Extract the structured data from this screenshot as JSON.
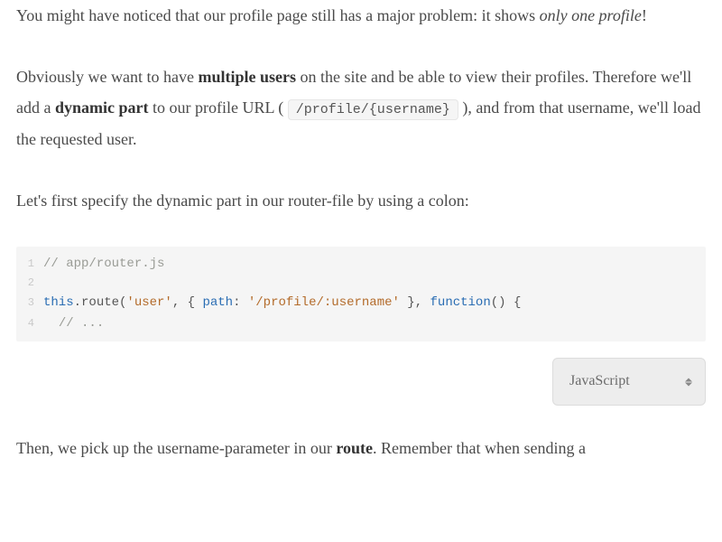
{
  "paragraphs": {
    "p1": {
      "a": "You might have noticed that our profile page still has a major problem: it shows ",
      "em": "only one profile",
      "b": "!"
    },
    "p2": {
      "a": "Obviously we want to have ",
      "strong1": "multiple users",
      "b": " on the site and be able to view their profiles. Therefore we'll add a ",
      "strong2": "dynamic part",
      "c": " to our profile URL ( ",
      "code": "/profile/{username}",
      "d": " ), and from that username, we'll load the requested user."
    },
    "p3": "Let's first specify the dynamic part in our router-file by using a colon:",
    "p4": {
      "a": "Then, we pick up the username-parameter in our ",
      "strong": "route",
      "b": ". Remember that when sending a"
    }
  },
  "code": {
    "lines": [
      {
        "n": "1",
        "tokens": [
          {
            "t": "// app/router.js",
            "c": "tok-comment"
          }
        ]
      },
      {
        "n": "2",
        "tokens": [
          {
            "t": "",
            "c": ""
          }
        ]
      },
      {
        "n": "3",
        "tokens": [
          {
            "t": "this",
            "c": "tok-kw"
          },
          {
            "t": ".route(",
            "c": "tok-punc"
          },
          {
            "t": "'user'",
            "c": "tok-str"
          },
          {
            "t": ", { ",
            "c": "tok-punc"
          },
          {
            "t": "path",
            "c": "tok-key"
          },
          {
            "t": ": ",
            "c": "tok-punc"
          },
          {
            "t": "'/profile/:username'",
            "c": "tok-str"
          },
          {
            "t": " }, ",
            "c": "tok-punc"
          },
          {
            "t": "function",
            "c": "tok-kw"
          },
          {
            "t": "() {",
            "c": "tok-punc"
          }
        ]
      },
      {
        "n": "4",
        "tokens": [
          {
            "t": "  ",
            "c": ""
          },
          {
            "t": "// ...",
            "c": "tok-comment"
          }
        ]
      }
    ]
  },
  "langSelect": {
    "selected": "JavaScript"
  }
}
